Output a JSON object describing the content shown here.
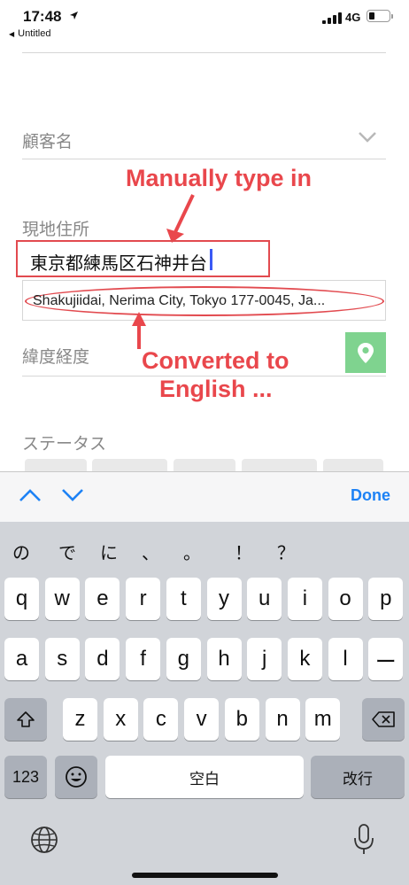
{
  "status_bar": {
    "time": "17:48",
    "back_app": "Untitled",
    "network": "4G",
    "battery_level": 0.3,
    "icons": [
      "location-arrow-icon",
      "signal-icon",
      "battery-icon"
    ]
  },
  "form": {
    "customer_name_label": "顧客名",
    "address_label": "現地住所",
    "address_input_value": "東京都練馬区石神井台",
    "address_converted_value": "Shakujiidai, Nerima City, Tokyo 177-0045, Ja...",
    "latlng_label": "緯度経度",
    "status_label": "ステータス"
  },
  "annotations": {
    "manual": "Manually type in",
    "converted_line1": "Converted to",
    "converted_line2": "English ..."
  },
  "keyboard": {
    "done_label": "Done",
    "candidates": [
      "の",
      "で",
      "に",
      "、",
      "。",
      "！",
      "？"
    ],
    "row1": [
      "q",
      "w",
      "e",
      "r",
      "t",
      "y",
      "u",
      "i",
      "o",
      "p"
    ],
    "row2": [
      "a",
      "s",
      "d",
      "f",
      "g",
      "h",
      "j",
      "k",
      "l",
      "ー"
    ],
    "row3": [
      "z",
      "x",
      "c",
      "v",
      "b",
      "n",
      "m"
    ],
    "numbers_label": "123",
    "space_label": "空白",
    "return_label": "改行"
  },
  "colors": {
    "accent": "#1d82f5",
    "annotation": "#e9474c",
    "map_button": "#7fd38f",
    "caret": "#3a59f5"
  }
}
